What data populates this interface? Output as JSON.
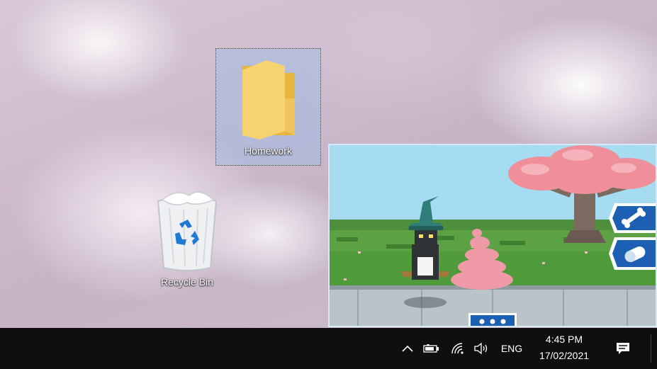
{
  "desktop": {
    "icons": [
      {
        "label": "Homework",
        "icon": "folder-icon",
        "selected": true
      },
      {
        "label": "Recycle Bin",
        "icon": "recycle-bin-icon",
        "selected": false
      }
    ]
  },
  "pip_window": {
    "content": "pixel-art-game-scene",
    "side_buttons": [
      "bone-icon",
      "pill-icon"
    ],
    "bottom_button": "more-dots-icon"
  },
  "taskbar": {
    "tray_icons": [
      "chevron-up-icon",
      "battery-icon",
      "wifi-icon",
      "volume-icon"
    ],
    "language": "ENG",
    "time": "4:45 PM",
    "date": "17/02/2021",
    "notification_icon": "notification-icon"
  },
  "colors": {
    "taskbar": "#0f0f10",
    "folder": "#f6d36f",
    "game_button": "#1d5fb3"
  }
}
